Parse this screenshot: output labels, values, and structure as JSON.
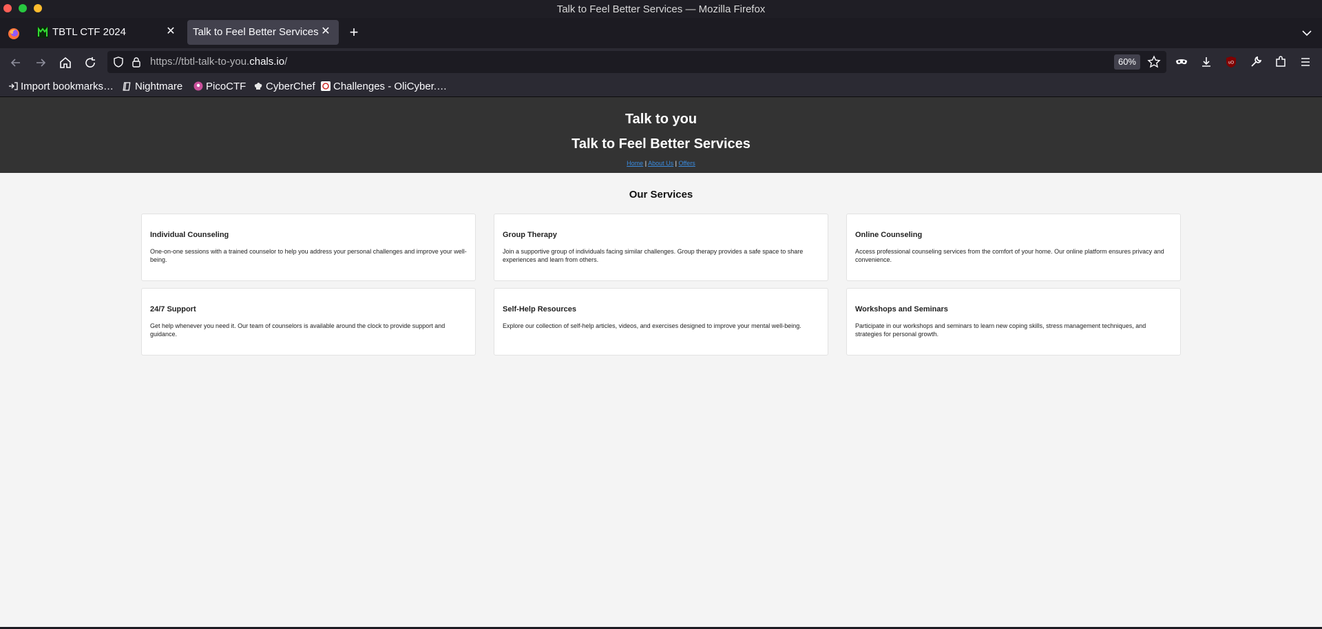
{
  "window": {
    "title": "Talk to Feel Better Services — Mozilla Firefox"
  },
  "tabs": [
    {
      "label": "TBTL CTF 2024",
      "icon": "tbtl-favicon"
    },
    {
      "label": "Talk to Feel Better Services",
      "active": true
    }
  ],
  "nav": {
    "url_prefix": "https://tbtl-talk-to-you.",
    "url_host": "chals.io",
    "url_suffix": "/",
    "zoom": "60%"
  },
  "bookmarks": [
    {
      "label": "Import bookmarks…",
      "icon": "import-icon"
    },
    {
      "label": "Nightmare",
      "icon": "book-icon"
    },
    {
      "label": "PicoCTF",
      "icon": "picoctf-icon"
    },
    {
      "label": "CyberChef",
      "icon": "chef-hat-icon"
    },
    {
      "label": "Challenges - OliCyber.…",
      "icon": "olicyber-icon"
    }
  ],
  "site": {
    "title": "Talk to you",
    "subtitle": "Talk to Feel Better Services",
    "nav_links": [
      "Home",
      "About Us",
      "Offers"
    ],
    "nav_separator": "|",
    "section_title": "Our Services",
    "services": [
      {
        "title": "Individual Counseling",
        "desc": "One-on-one sessions with a trained counselor to help you address your personal challenges and improve your well-being."
      },
      {
        "title": "Group Therapy",
        "desc": "Join a supportive group of individuals facing similar challenges. Group therapy provides a safe space to share experiences and learn from others."
      },
      {
        "title": "Online Counseling",
        "desc": "Access professional counseling services from the comfort of your home. Our online platform ensures privacy and convenience."
      },
      {
        "title": "24/7 Support",
        "desc": "Get help whenever you need it. Our team of counselors is available around the clock to provide support and guidance."
      },
      {
        "title": "Self-Help Resources",
        "desc": "Explore our collection of self-help articles, videos, and exercises designed to improve your mental well-being."
      },
      {
        "title": "Workshops and Seminars",
        "desc": "Participate in our workshops and seminars to learn new coping skills, stress management techniques, and strategies for personal growth."
      }
    ]
  },
  "colors": {
    "header_bg": "#333333",
    "link": "#3a8ce0",
    "page_bg": "#f4f4f4",
    "browser_dark": "#1c1b22"
  }
}
